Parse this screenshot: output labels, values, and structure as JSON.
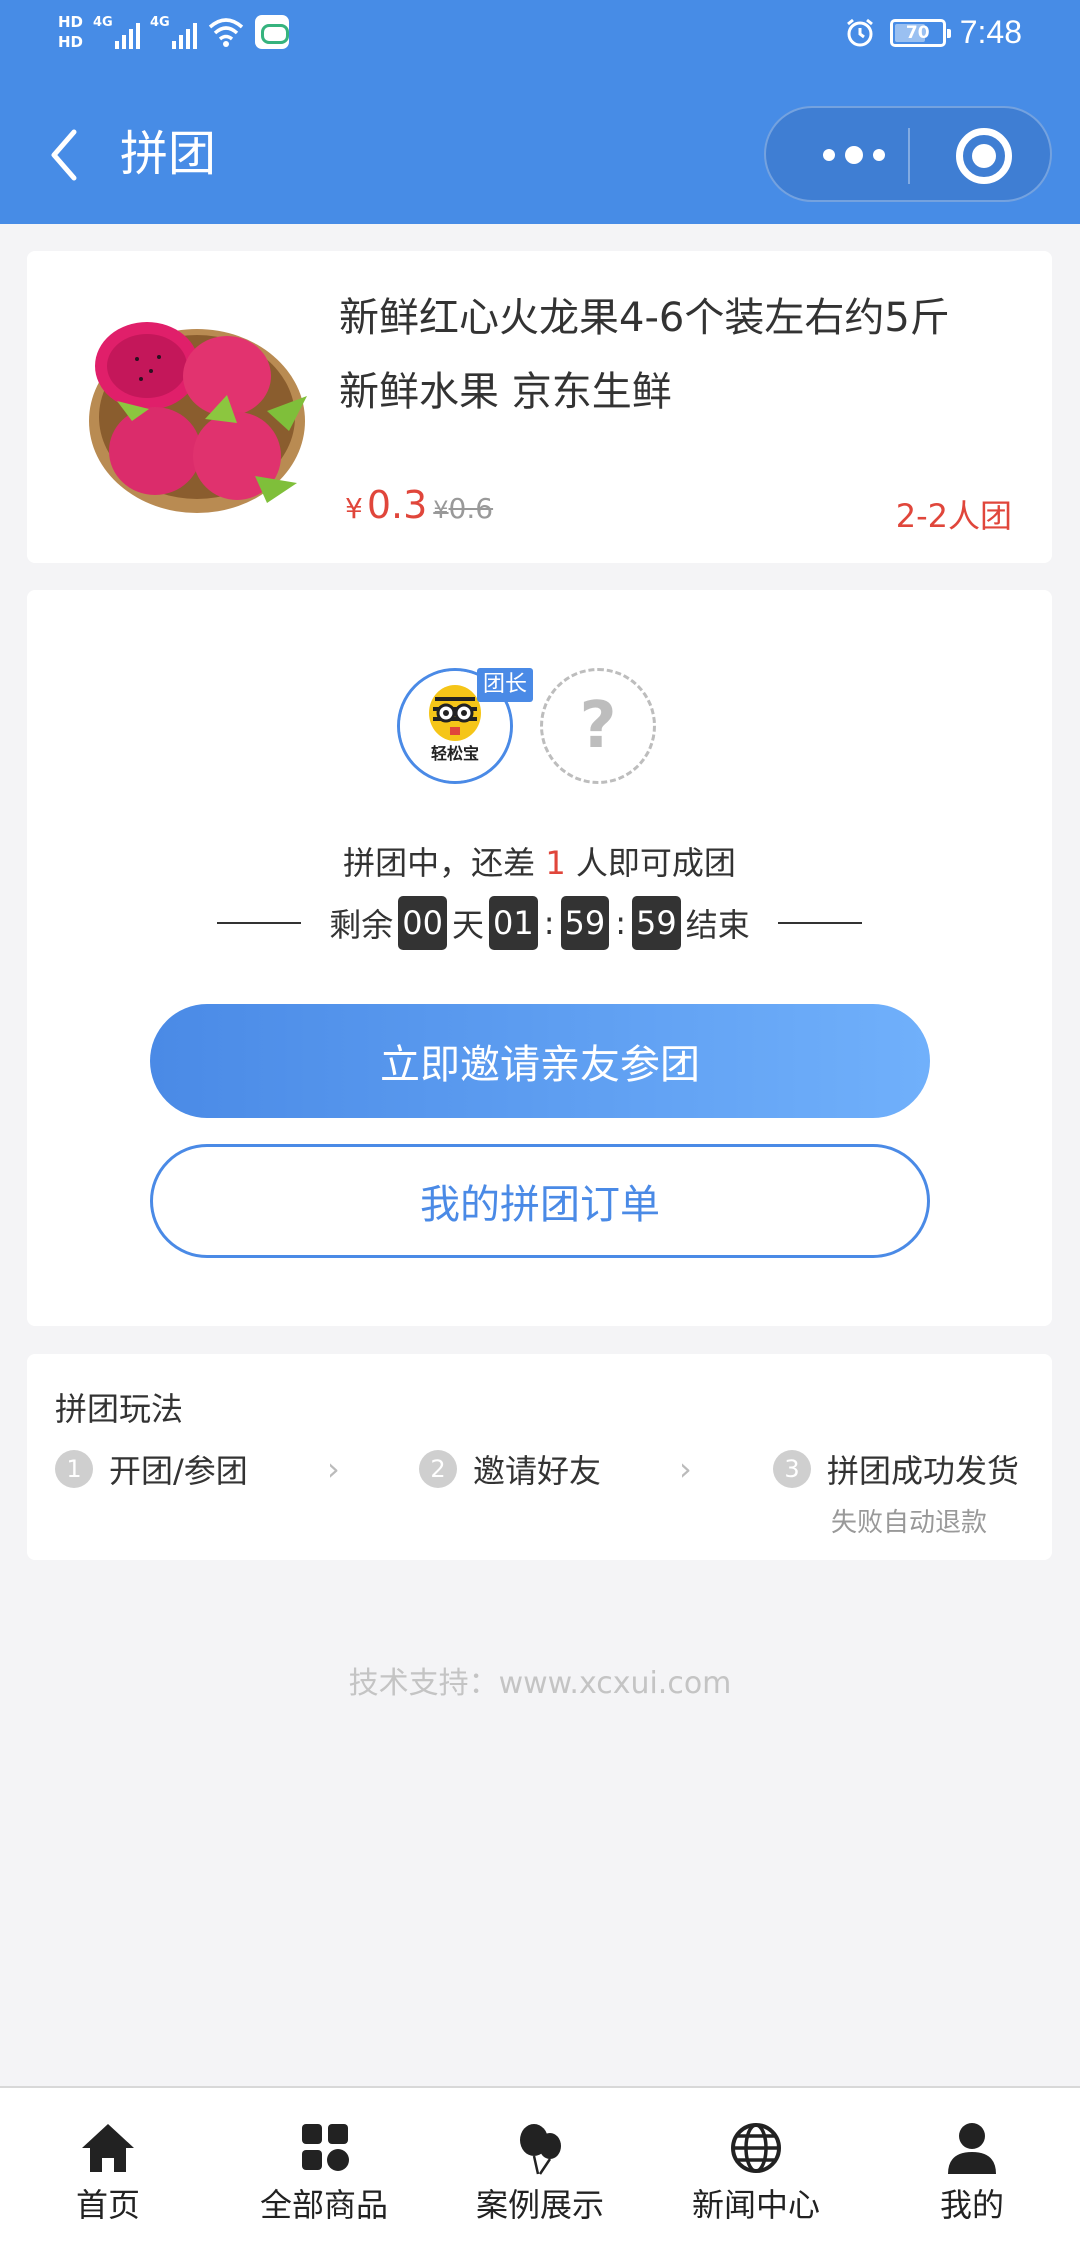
{
  "status_bar": {
    "hd1": "HD",
    "hd2": "HD",
    "net1": "4G",
    "net2": "4G",
    "battery": "70",
    "time": "7:48"
  },
  "nav": {
    "title": "拼团"
  },
  "product": {
    "title_line1": "新鲜红心火龙果4-6个装左右约5斤",
    "title_line2": "新鲜水果 京东生鲜",
    "currency": "¥",
    "price": "0.3",
    "original_price": "0.6",
    "group_size": "2-2人团"
  },
  "group": {
    "leader_badge": "团长",
    "avatar_text": "轻松宝",
    "placeholder": "?",
    "status_prefix": "拼团中，还差 ",
    "status_count": "1",
    "status_suffix": " 人即可成团",
    "remaining_label": "剩余",
    "days": "00",
    "day_unit": "天",
    "hours": "01",
    "minutes": "59",
    "seconds": "59",
    "end_label": "结束",
    "invite_button": "立即邀请亲友参团",
    "orders_button": "我的拼团订单"
  },
  "rules": {
    "title": "拼团玩法",
    "steps": [
      {
        "num": "1",
        "label": "开团/参团"
      },
      {
        "num": "2",
        "label": "邀请好友"
      },
      {
        "num": "3",
        "label": "拼团成功发货"
      }
    ],
    "fail_note": "失败自动退款"
  },
  "footer_note": "技术支持：www.xcxui.com",
  "tabbar": {
    "items": [
      {
        "label": "首页",
        "icon": "home-icon"
      },
      {
        "label": "全部商品",
        "icon": "grid-icon"
      },
      {
        "label": "案例展示",
        "icon": "balloons-icon"
      },
      {
        "label": "新闻中心",
        "icon": "globe-icon"
      },
      {
        "label": "我的",
        "icon": "user-icon"
      }
    ]
  },
  "colors": {
    "brand_blue": "#478ce6",
    "price_red": "#e0463b"
  }
}
